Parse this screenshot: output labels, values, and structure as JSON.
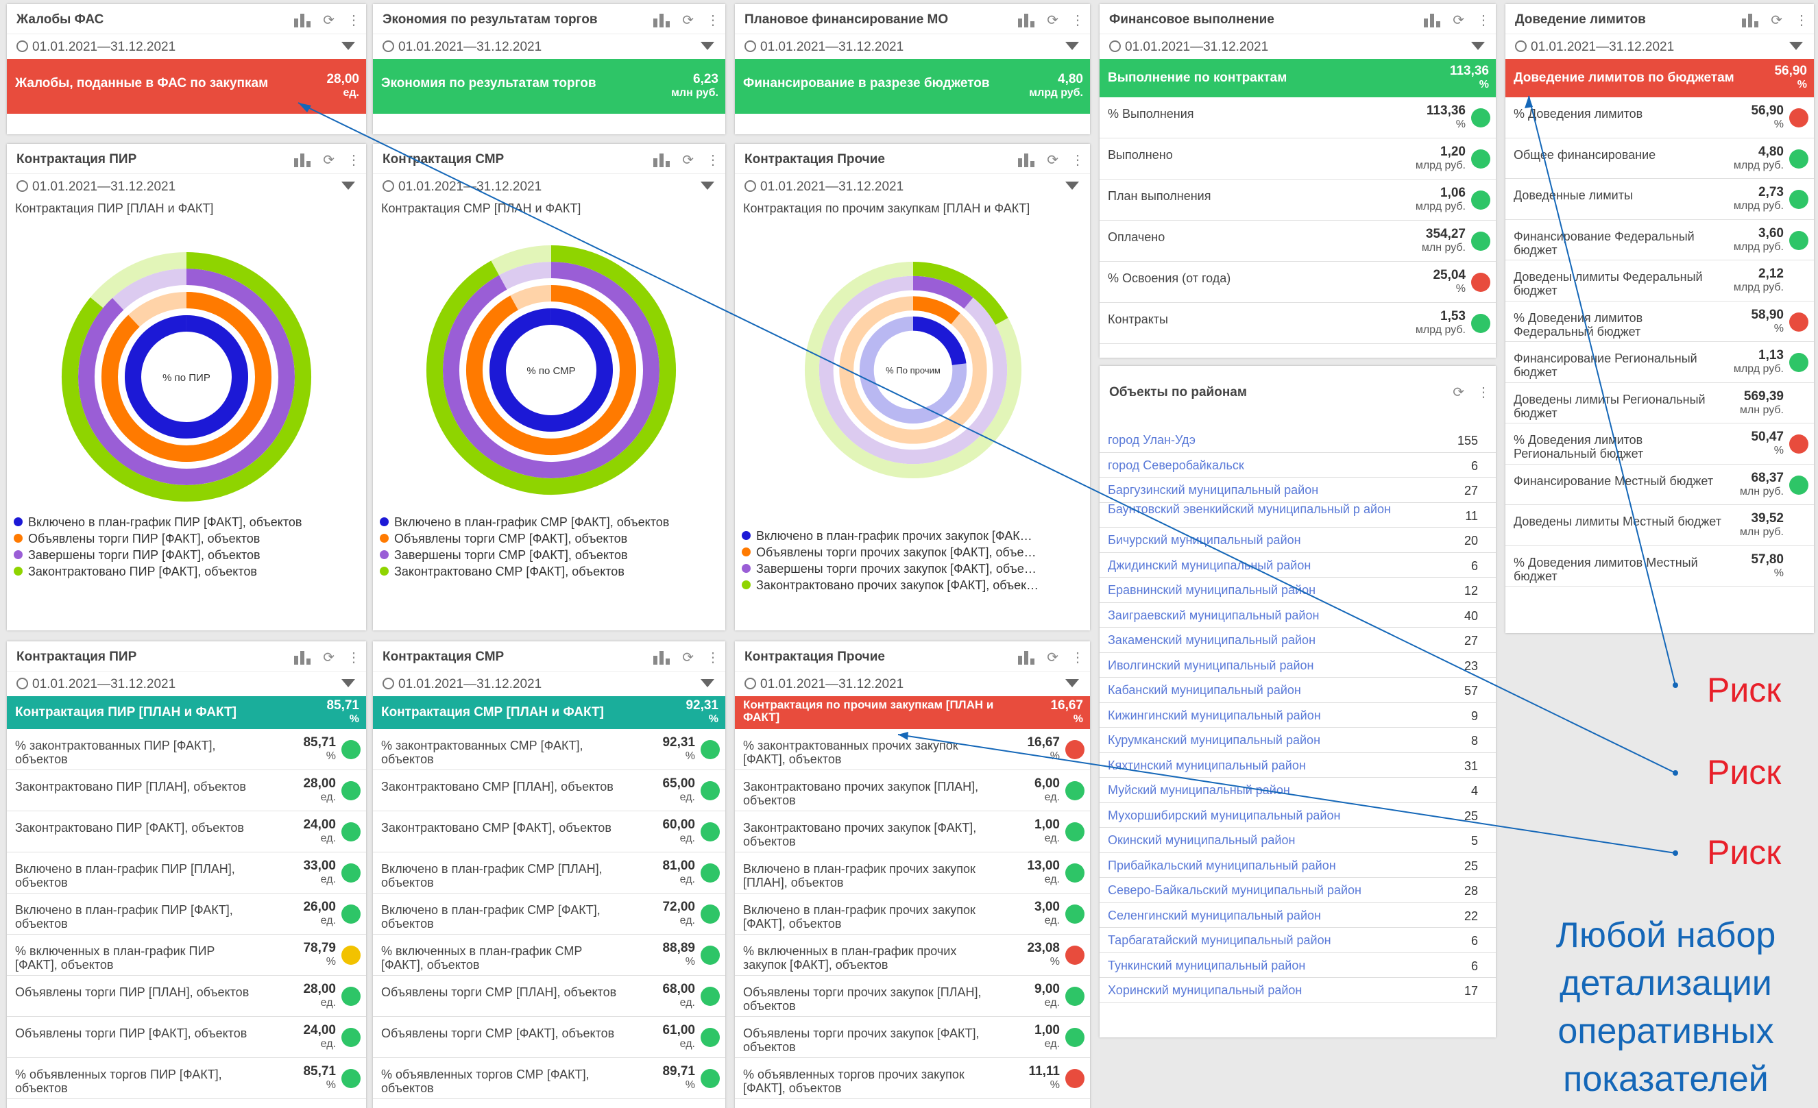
{
  "common": {
    "date": "01.01.2021—31.12.2021"
  },
  "fas": {
    "title": "Жалобы ФАС",
    "band_label": "Жалобы, поданные в ФАС по закупкам",
    "band_value": "28,00",
    "band_unit": "ед."
  },
  "econ": {
    "title": "Экономия по результатам торгов",
    "band_label": "Экономия по результатам торгов",
    "band_value": "6,23",
    "band_unit": "млн руб."
  },
  "plan": {
    "title": "Плановое финансирование МО",
    "band_label": "Финансирование в разрезе бюджетов",
    "band_value": "4,80",
    "band_unit": "млрд руб."
  },
  "pir_chart": {
    "title": "Контрактация ПИР",
    "subtitle": "Контрактация ПИР [ПЛАН и ФАКТ]",
    "center": "% по ПИР",
    "legend": [
      "Включено в план-график ПИР [ФАКТ], объектов",
      "Объявлены торги ПИР [ФАКТ], объектов",
      "Завершены торги ПИР [ФАКТ], объектов",
      "Законтрактовано ПИР [ФАКТ], объектов"
    ]
  },
  "smr_chart": {
    "title": "Контрактация СМР",
    "subtitle": "Контрактация СМР [ПЛАН и ФАКТ]",
    "center": "% по СМР",
    "legend": [
      "Включено в план-график СМР [ФАКТ], объектов",
      "Объявлены торги СМР [ФАКТ], объектов",
      "Завершены торги СМР [ФАКТ], объектов",
      "Законтрактовано СМР [ФАКТ], объектов"
    ]
  },
  "other_chart": {
    "title": "Контрактация Прочие",
    "subtitle": "Контрактация по прочим закупкам [ПЛАН и ФАКТ]",
    "center": "% По прочим",
    "legend": [
      "Включено в план-график прочих закупок [ФАК…",
      "Объявлены торги прочих закупок [ФАКТ], объе…",
      "Завершены торги прочих закупок [ФАКТ], объе…",
      "Законтрактовано прочих закупок [ФАКТ], объек…"
    ]
  },
  "chart_colors": [
    "#1c19d6",
    "#ff7a00",
    "#9a5ed6",
    "#8fd400"
  ],
  "fin": {
    "title": "Финансовое выполнение",
    "band_label": "Выполнение по контрактам",
    "band_value": "113,36",
    "band_unit": "%",
    "rows": [
      {
        "l": "% Выполнения",
        "v": "113,36",
        "u": "%",
        "c": "g"
      },
      {
        "l": "Выполнено",
        "v": "1,20",
        "u": "млрд руб.",
        "c": "g"
      },
      {
        "l": "План выполнения",
        "v": "1,06",
        "u": "млрд руб.",
        "c": "g"
      },
      {
        "l": "Оплачено",
        "v": "354,27",
        "u": "млн руб.",
        "c": "g"
      },
      {
        "l": "% Освоения (от года)",
        "v": "25,04",
        "u": "%",
        "c": "r"
      },
      {
        "l": "Контракты",
        "v": "1,53",
        "u": "млрд руб.",
        "c": "g"
      }
    ]
  },
  "lim": {
    "title": "Доведение лимитов",
    "band_label": "Доведение лимитов по бюджетам",
    "band_value": "56,90",
    "band_unit": "%",
    "rows": [
      {
        "l": "% Доведения лимитов",
        "v": "56,90",
        "u": "%",
        "c": "r"
      },
      {
        "l": "Общее финансирование",
        "v": "4,80",
        "u": "млрд руб.",
        "c": "g"
      },
      {
        "l": "Доведенные лимиты",
        "v": "2,73",
        "u": "млрд руб.",
        "c": "g"
      },
      {
        "l": "Финансирование Федеральный бюджет",
        "v": "3,60",
        "u": "млрд руб.",
        "c": "g"
      },
      {
        "l": "Доведены лимиты Федеральный бюджет",
        "v": "2,12",
        "u": "млрд руб.",
        "c": ""
      },
      {
        "l": "% Доведения лимитов Федеральный бюджет",
        "v": "58,90",
        "u": "%",
        "c": "r"
      },
      {
        "l": "Финансирование Региональный бюджет",
        "v": "1,13",
        "u": "млрд руб.",
        "c": "g"
      },
      {
        "l": "Доведены лимиты Региональный бюджет",
        "v": "569,39",
        "u": "млн руб.",
        "c": ""
      },
      {
        "l": "% Доведения лимитов Региональный бюджет",
        "v": "50,47",
        "u": "%",
        "c": "r"
      },
      {
        "l": "Финансирование Местный бюджет",
        "v": "68,37",
        "u": "млн руб.",
        "c": "g"
      },
      {
        "l": "Доведены лимиты Местный бюджет",
        "v": "39,52",
        "u": "млн руб.",
        "c": ""
      },
      {
        "l": "% Доведения лимитов Местный бюджет",
        "v": "57,80",
        "u": "%",
        "c": ""
      }
    ]
  },
  "obj": {
    "title": "Объекты по районам",
    "rows": [
      [
        "город Улан-Удэ",
        "155"
      ],
      [
        "город Северобайкальск",
        "6"
      ],
      [
        "Баргузинский муниципальный район",
        "27"
      ],
      [
        "Баунтовский эвенкийский муниципальный р айон",
        "11"
      ],
      [
        "Бичурский муниципальный район",
        "20"
      ],
      [
        "Джидинский муниципальный район",
        "6"
      ],
      [
        "Еравнинский муниципальный район",
        "12"
      ],
      [
        "Заиграевский муниципальный район",
        "40"
      ],
      [
        "Закаменский муниципальный район",
        "27"
      ],
      [
        "Иволгинский муниципальный район",
        "23"
      ],
      [
        "Кабанский муниципальный район",
        "57"
      ],
      [
        "Кижингинский муниципальный район",
        "9"
      ],
      [
        "Курумканский муниципальный район",
        "8"
      ],
      [
        "Кяхтинский муниципальный район",
        "31"
      ],
      [
        "Муйский муниципальный район",
        "4"
      ],
      [
        "Мухоршибирский муниципальный район",
        "25"
      ],
      [
        "Окинский муниципальный район",
        "5"
      ],
      [
        "Прибайкальский муниципальный район",
        "25"
      ],
      [
        "Северо-Байкальский муниципальный район",
        "28"
      ],
      [
        "Селенгинский муниципальный район",
        "22"
      ],
      [
        "Тарбагатайский муниципальный район",
        "6"
      ],
      [
        "Тункинский муниципальный район",
        "6"
      ],
      [
        "Хоринский муниципальный район",
        "17"
      ]
    ]
  },
  "pir_t": {
    "title": "Контрактация ПИР",
    "band_label": "Контрактация ПИР [ПЛАН и ФАКТ]",
    "band_value": "85,71",
    "band_unit": "%",
    "rows": [
      {
        "l": "% законтрактованных ПИР [ФАКТ], объектов",
        "v": "85,71",
        "u": "%",
        "c": "g"
      },
      {
        "l": "Законтрактовано ПИР [ПЛАН], объектов",
        "v": "28,00",
        "u": "ед.",
        "c": "g"
      },
      {
        "l": "Законтрактовано ПИР [ФАКТ], объектов",
        "v": "24,00",
        "u": "ед.",
        "c": "g"
      },
      {
        "l": "Включено в план-график ПИР [ПЛАН], объектов",
        "v": "33,00",
        "u": "ед.",
        "c": "g"
      },
      {
        "l": "Включено в план-график ПИР [ФАКТ], объектов",
        "v": "26,00",
        "u": "ед.",
        "c": "g"
      },
      {
        "l": "% включенных в план-график ПИР [ФАКТ], объектов",
        "v": "78,79",
        "u": "%",
        "c": "y"
      },
      {
        "l": "Объявлены торги ПИР [ПЛАН], объектов",
        "v": "28,00",
        "u": "ед.",
        "c": "g"
      },
      {
        "l": "Объявлены торги ПИР [ФАКТ], объектов",
        "v": "24,00",
        "u": "ед.",
        "c": "g"
      },
      {
        "l": "% объявленных торгов ПИР [ФАКТ], объектов",
        "v": "85,71",
        "u": "%",
        "c": "g"
      }
    ]
  },
  "smr_t": {
    "title": "Контрактация СМР",
    "band_label": "Контрактация СМР [ПЛАН и ФАКТ]",
    "band_value": "92,31",
    "band_unit": "%",
    "rows": [
      {
        "l": "% законтрактованных СМР [ФАКТ], объектов",
        "v": "92,31",
        "u": "%",
        "c": "g"
      },
      {
        "l": "Законтрактовано СМР [ПЛАН], объектов",
        "v": "65,00",
        "u": "ед.",
        "c": "g"
      },
      {
        "l": "Законтрактовано СМР [ФАКТ], объектов",
        "v": "60,00",
        "u": "ед.",
        "c": "g"
      },
      {
        "l": "Включено в план-график СМР [ПЛАН], объектов",
        "v": "81,00",
        "u": "ед.",
        "c": "g"
      },
      {
        "l": "Включено в план-график СМР [ФАКТ], объектов",
        "v": "72,00",
        "u": "ед.",
        "c": "g"
      },
      {
        "l": "% включенных в план-график СМР [ФАКТ], объектов",
        "v": "88,89",
        "u": "%",
        "c": "g"
      },
      {
        "l": "Объявлены торги СМР [ПЛАН], объектов",
        "v": "68,00",
        "u": "ед.",
        "c": "g"
      },
      {
        "l": "Объявлены торги СМР [ФАКТ], объектов",
        "v": "61,00",
        "u": "ед.",
        "c": "g"
      },
      {
        "l": "% объявленных торгов СМР [ФАКТ], объектов",
        "v": "89,71",
        "u": "%",
        "c": "g"
      }
    ]
  },
  "oth_t": {
    "title": "Контрактация Прочие",
    "band_label": "Контрактация по прочим закупкам [ПЛАН и ФАКТ]",
    "band_value": "16,67",
    "band_unit": "%",
    "rows": [
      {
        "l": "% законтрактованных прочих закупок [ФАКТ], объектов",
        "v": "16,67",
        "u": "%",
        "c": "r"
      },
      {
        "l": "Законтрактовано прочих закупок [ПЛАН], объектов",
        "v": "6,00",
        "u": "ед.",
        "c": "g"
      },
      {
        "l": "Законтрактовано прочих закупок [ФАКТ], объектов",
        "v": "1,00",
        "u": "ед.",
        "c": "g"
      },
      {
        "l": "Включено в план-график прочих закупок [ПЛАН], объектов",
        "v": "13,00",
        "u": "ед.",
        "c": "g"
      },
      {
        "l": "Включено в план-график прочих закупок [ФАКТ], объектов",
        "v": "3,00",
        "u": "ед.",
        "c": "g"
      },
      {
        "l": "% включенных в план-график прочих закупок [ФАКТ], объектов",
        "v": "23,08",
        "u": "%",
        "c": "r"
      },
      {
        "l": "Объявлены торги прочих закупок [ПЛАН], объектов",
        "v": "9,00",
        "u": "ед.",
        "c": "g"
      },
      {
        "l": "Объявлены торги прочих закупок [ФАКТ], объектов",
        "v": "1,00",
        "u": "ед.",
        "c": "g"
      },
      {
        "l": "% объявленных торгов прочих закупок [ФАКТ], объектов",
        "v": "11,11",
        "u": "%",
        "c": "r"
      }
    ]
  },
  "annotations": {
    "risk": "Риск",
    "caption_1": "Любой набор",
    "caption_2": "детализации",
    "caption_3": "оперативных",
    "caption_4": "показателей"
  }
}
